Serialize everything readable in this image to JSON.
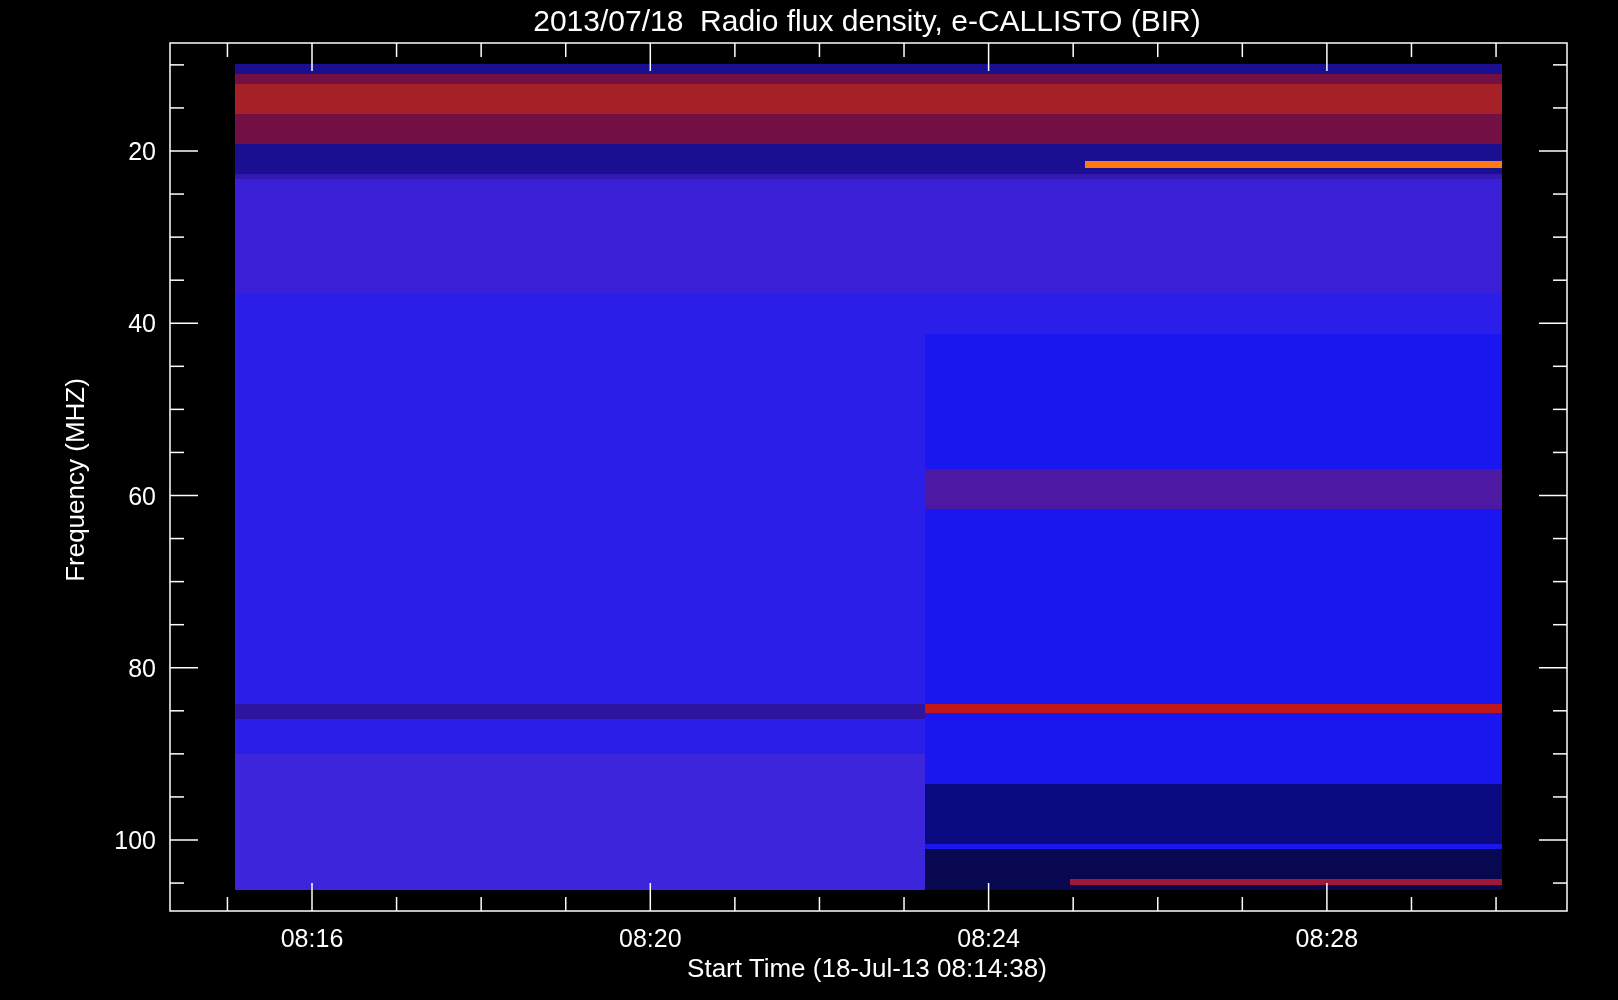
{
  "title": "2013/07/18  Radio flux density, e-CALLISTO (BIR)",
  "y_axis": {
    "label": "Frequency (MHZ)",
    "ticks": [
      "20",
      "40",
      "60",
      "80",
      "100"
    ]
  },
  "x_axis": {
    "label": "Start Time (18-Jul-13 08:14:38)",
    "ticks": [
      "08:16",
      "08:20",
      "08:24",
      "08:28"
    ]
  }
}
